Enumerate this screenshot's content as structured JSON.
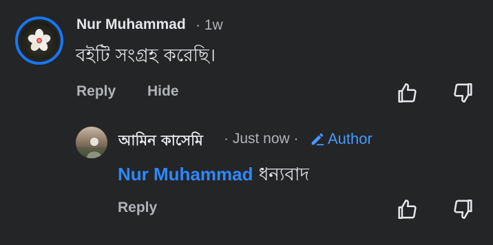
{
  "comment": {
    "author": "Nur Muhammad",
    "time": "· 1w",
    "text": "বইটি সংগ্রহ করেছি।",
    "actions": {
      "reply": "Reply",
      "hide": "Hide"
    },
    "avatar_icon": "flower-avatar-icon"
  },
  "reply": {
    "author": "আমিন কাসেমি",
    "time": "· Just now ·",
    "badge": "Author",
    "mention": "Nur Muhammad",
    "text": "ধন্যবাদ",
    "actions": {
      "reply": "Reply"
    },
    "badge_icon": "pencil-icon"
  },
  "colors": {
    "background": "#242526",
    "accent": "#1877f2",
    "muted": "#b0b3b8",
    "mention": "#2d88ff"
  }
}
